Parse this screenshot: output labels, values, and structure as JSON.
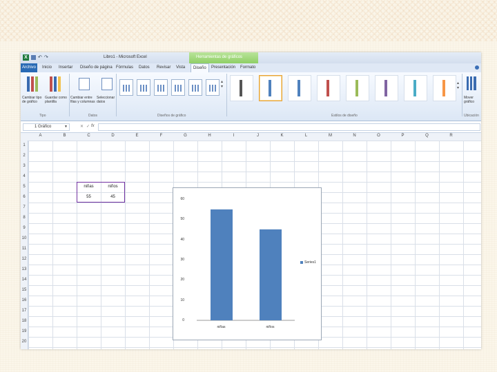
{
  "window": {
    "title": "Libro1 - Microsoft Excel",
    "context_tab_group": "Herramientas de gráficos"
  },
  "tabs": [
    "Archivo",
    "Inicio",
    "Insertar",
    "Diseño de página",
    "Fórmulas",
    "Datos",
    "Revisar",
    "Vista",
    "Diseño",
    "Presentación",
    "Formato"
  ],
  "active_tab": "Diseño",
  "ribbon": {
    "groups": {
      "tipo": "Tipo",
      "datos": "Datos",
      "disenos": "Diseños de gráfico",
      "estilos": "Estilos de diseño",
      "ubicacion": "Ubicación"
    },
    "buttons": {
      "cambiar_tipo": "Cambiar tipo de gráfico",
      "guardar_plantilla": "Guardar como plantilla",
      "cambiar_fila": "Cambiar entre filas y columnas",
      "seleccionar_datos": "Seleccionar datos",
      "mover_grafico": "Mover gráfico"
    },
    "style_colors": [
      "#555555",
      "#4f81bd",
      "#4f81bd",
      "#c0504d",
      "#9bbb59",
      "#8064a2",
      "#4bacc6",
      "#f79646"
    ]
  },
  "formula_bar": {
    "name_box": "1 Gráfico",
    "fx": "fx"
  },
  "columns": [
    "A",
    "B",
    "C",
    "D",
    "E",
    "F",
    "G",
    "H",
    "I",
    "J",
    "K",
    "L",
    "M",
    "N",
    "O",
    "P",
    "Q",
    "R"
  ],
  "rows": [
    "1",
    "2",
    "3",
    "4",
    "5",
    "6",
    "7",
    "8",
    "9",
    "10",
    "11",
    "12",
    "13",
    "14",
    "15",
    "16",
    "17",
    "18",
    "19",
    "20"
  ],
  "cells": {
    "c5": "niñas",
    "d5": "niños",
    "c6": "55",
    "d6": "45"
  },
  "chart_data": {
    "type": "bar",
    "categories": [
      "niñas",
      "niños"
    ],
    "series": [
      {
        "name": "Series1",
        "values": [
          55,
          45
        ],
        "color": "#4f81bd"
      }
    ],
    "yticks": [
      "0",
      "10",
      "20",
      "30",
      "40",
      "50",
      "60"
    ],
    "ylim": [
      0,
      60
    ],
    "legend": "right"
  }
}
